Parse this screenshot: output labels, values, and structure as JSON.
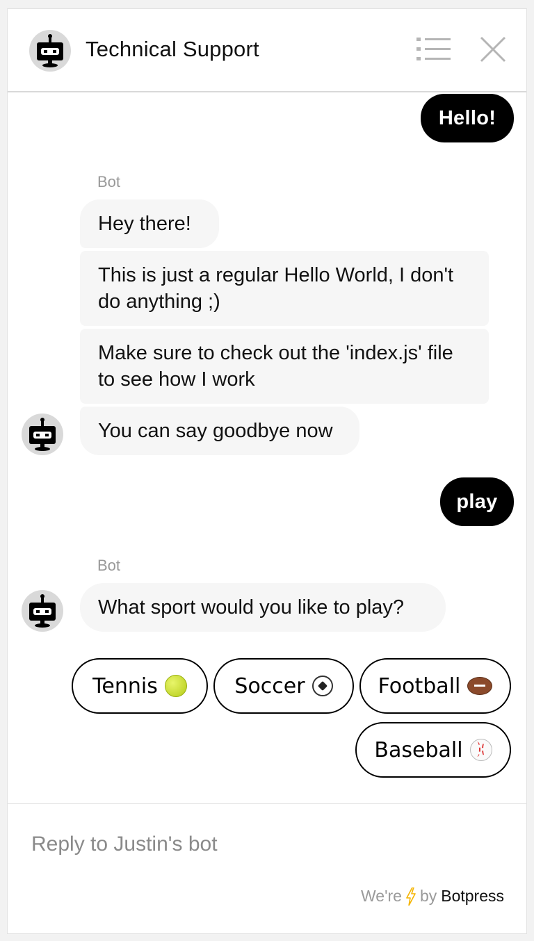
{
  "header": {
    "title": "Technical Support",
    "menu_icon": "list-icon",
    "close_icon": "close-icon"
  },
  "messages": [
    {
      "from": "user",
      "text": "Hello!"
    },
    {
      "from": "bot",
      "sender": "Bot",
      "bubbles": [
        "Hey there!",
        "This is just a regular Hello World, I don't do anything ;)",
        "Make sure to check out the 'index.js' file to see how I work",
        "You can say goodbye now"
      ]
    },
    {
      "from": "user",
      "text": "play"
    },
    {
      "from": "bot",
      "sender": "Bot",
      "bubbles": [
        "What sport would you like to play?"
      ]
    }
  ],
  "quick_replies": [
    {
      "label": "Tennis",
      "icon": "tennis-ball-icon"
    },
    {
      "label": "Soccer",
      "icon": "soccer-ball-icon"
    },
    {
      "label": "Football",
      "icon": "football-icon"
    },
    {
      "label": "Baseball",
      "icon": "baseball-icon"
    }
  ],
  "composer": {
    "placeholder": "Reply to Justin's bot"
  },
  "footer": {
    "prefix": "We're",
    "by": "by",
    "brand": "Botpress",
    "icon": "lightning-icon"
  },
  "colors": {
    "user_bubble": "#000000",
    "bot_bubble": "#f6f6f6",
    "avatar_bg": "#d9d9d9",
    "lightning": "#f5b400"
  }
}
